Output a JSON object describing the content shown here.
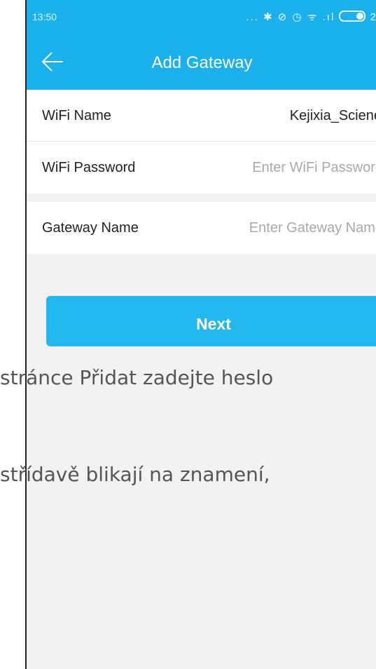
{
  "status_bar": {
    "time": "13:50",
    "icons_text": "... ✱ ⊘ ◷ ᯤ .ıl",
    "battery_partial": "2"
  },
  "app_bar": {
    "title": "Add Gateway",
    "back_icon": "arrow-left-icon"
  },
  "form": {
    "wifi_name_label": "WiFi Name",
    "wifi_name_value": "Kejixia_Sciene",
    "wifi_password_label": "WiFi Password",
    "wifi_password_placeholder": "Enter WiFi Password",
    "gateway_name_label": "Gateway Name",
    "gateway_name_placeholder": "Enter Gateway Name"
  },
  "next_button": {
    "label": "Next"
  },
  "document_text": {
    "line1": "stránce Přidat zadejte heslo",
    "line2": "střídavě blikají na znamení,"
  },
  "colors": {
    "accent": "#1ab1ec",
    "button": "#22b7ee",
    "background": "#f2f2f2"
  }
}
